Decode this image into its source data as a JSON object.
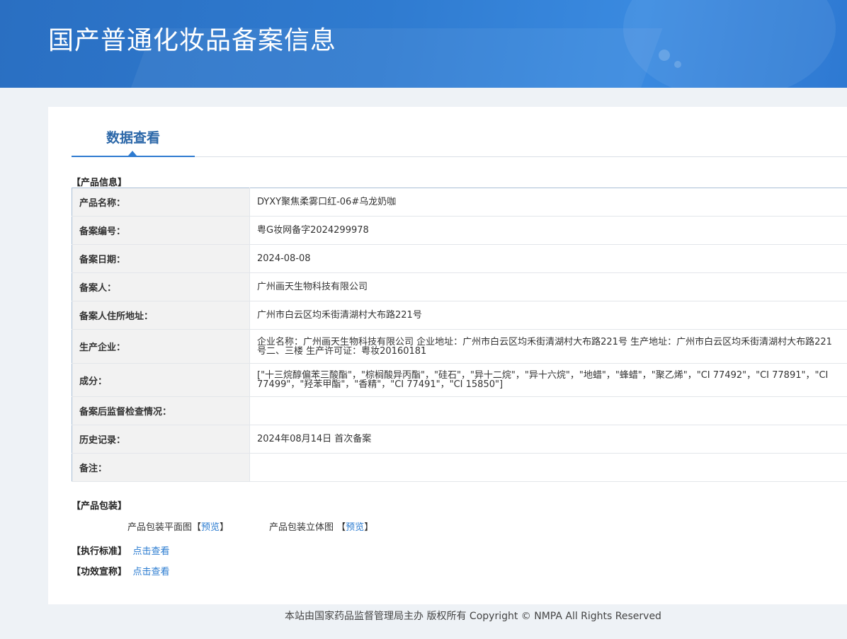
{
  "header": {
    "title": "国产普通化妆品备案信息"
  },
  "tab": {
    "label": "数据查看"
  },
  "product_info": {
    "section": "【产品信息】",
    "rows": [
      {
        "label": "产品名称：",
        "value": "DYXY聚焦柔雾口红-06#乌龙奶咖"
      },
      {
        "label": "备案编号：",
        "value": "粤G妆网备字2024299978"
      },
      {
        "label": "备案日期：",
        "value": "2024-08-08"
      },
      {
        "label": "备案人：",
        "value": "广州画天生物科技有限公司"
      },
      {
        "label": "备案人住所地址：",
        "value": "广州市白云区均禾街清湖村大布路221号"
      },
      {
        "label": "生产企业：",
        "value": "企业名称：广州画天生物科技有限公司 企业地址：广州市白云区均禾街清湖村大布路221号 生产地址：广州市白云区均禾街清湖村大布路221号二、三楼 生产许可证：粤妆20160181"
      },
      {
        "label": "成分：",
        "value": "[\"十三烷醇偏苯三酸酯\"，\"棕榈酸异丙酯\"，\"硅石\"，\"异十二烷\"，\"异十六烷\"，\"地蜡\"，\"蜂蜡\"，\"聚乙烯\"，\"CI 77492\"，\"CI 77891\"，\"CI 77499\"，\"羟苯甲酯\"，\"香精\"，\"CI 77491\"，\"CI 15850\"]"
      },
      {
        "label": "备案后监督检查情况：",
        "value": ""
      },
      {
        "label": "历史记录：",
        "value": "2024年08月14日 首次备案"
      },
      {
        "label": "备注：",
        "value": ""
      }
    ]
  },
  "packaging": {
    "section": "【产品包装】",
    "flat": {
      "label": "产品包装平面图",
      "open": "【",
      "link": "预览",
      "close": "】"
    },
    "stereo": {
      "label": "产品包装立体图",
      "open": "【",
      "link": "预览",
      "close": "】"
    }
  },
  "standard": {
    "section": "【执行标准】",
    "link": "点击查看"
  },
  "efficacy": {
    "section": "【功效宣称】",
    "link": "点击查看"
  },
  "footer": {
    "text": "本站由国家药品监督管理局主办 版权所有 Copyright © NMPA All Rights Reserved"
  }
}
